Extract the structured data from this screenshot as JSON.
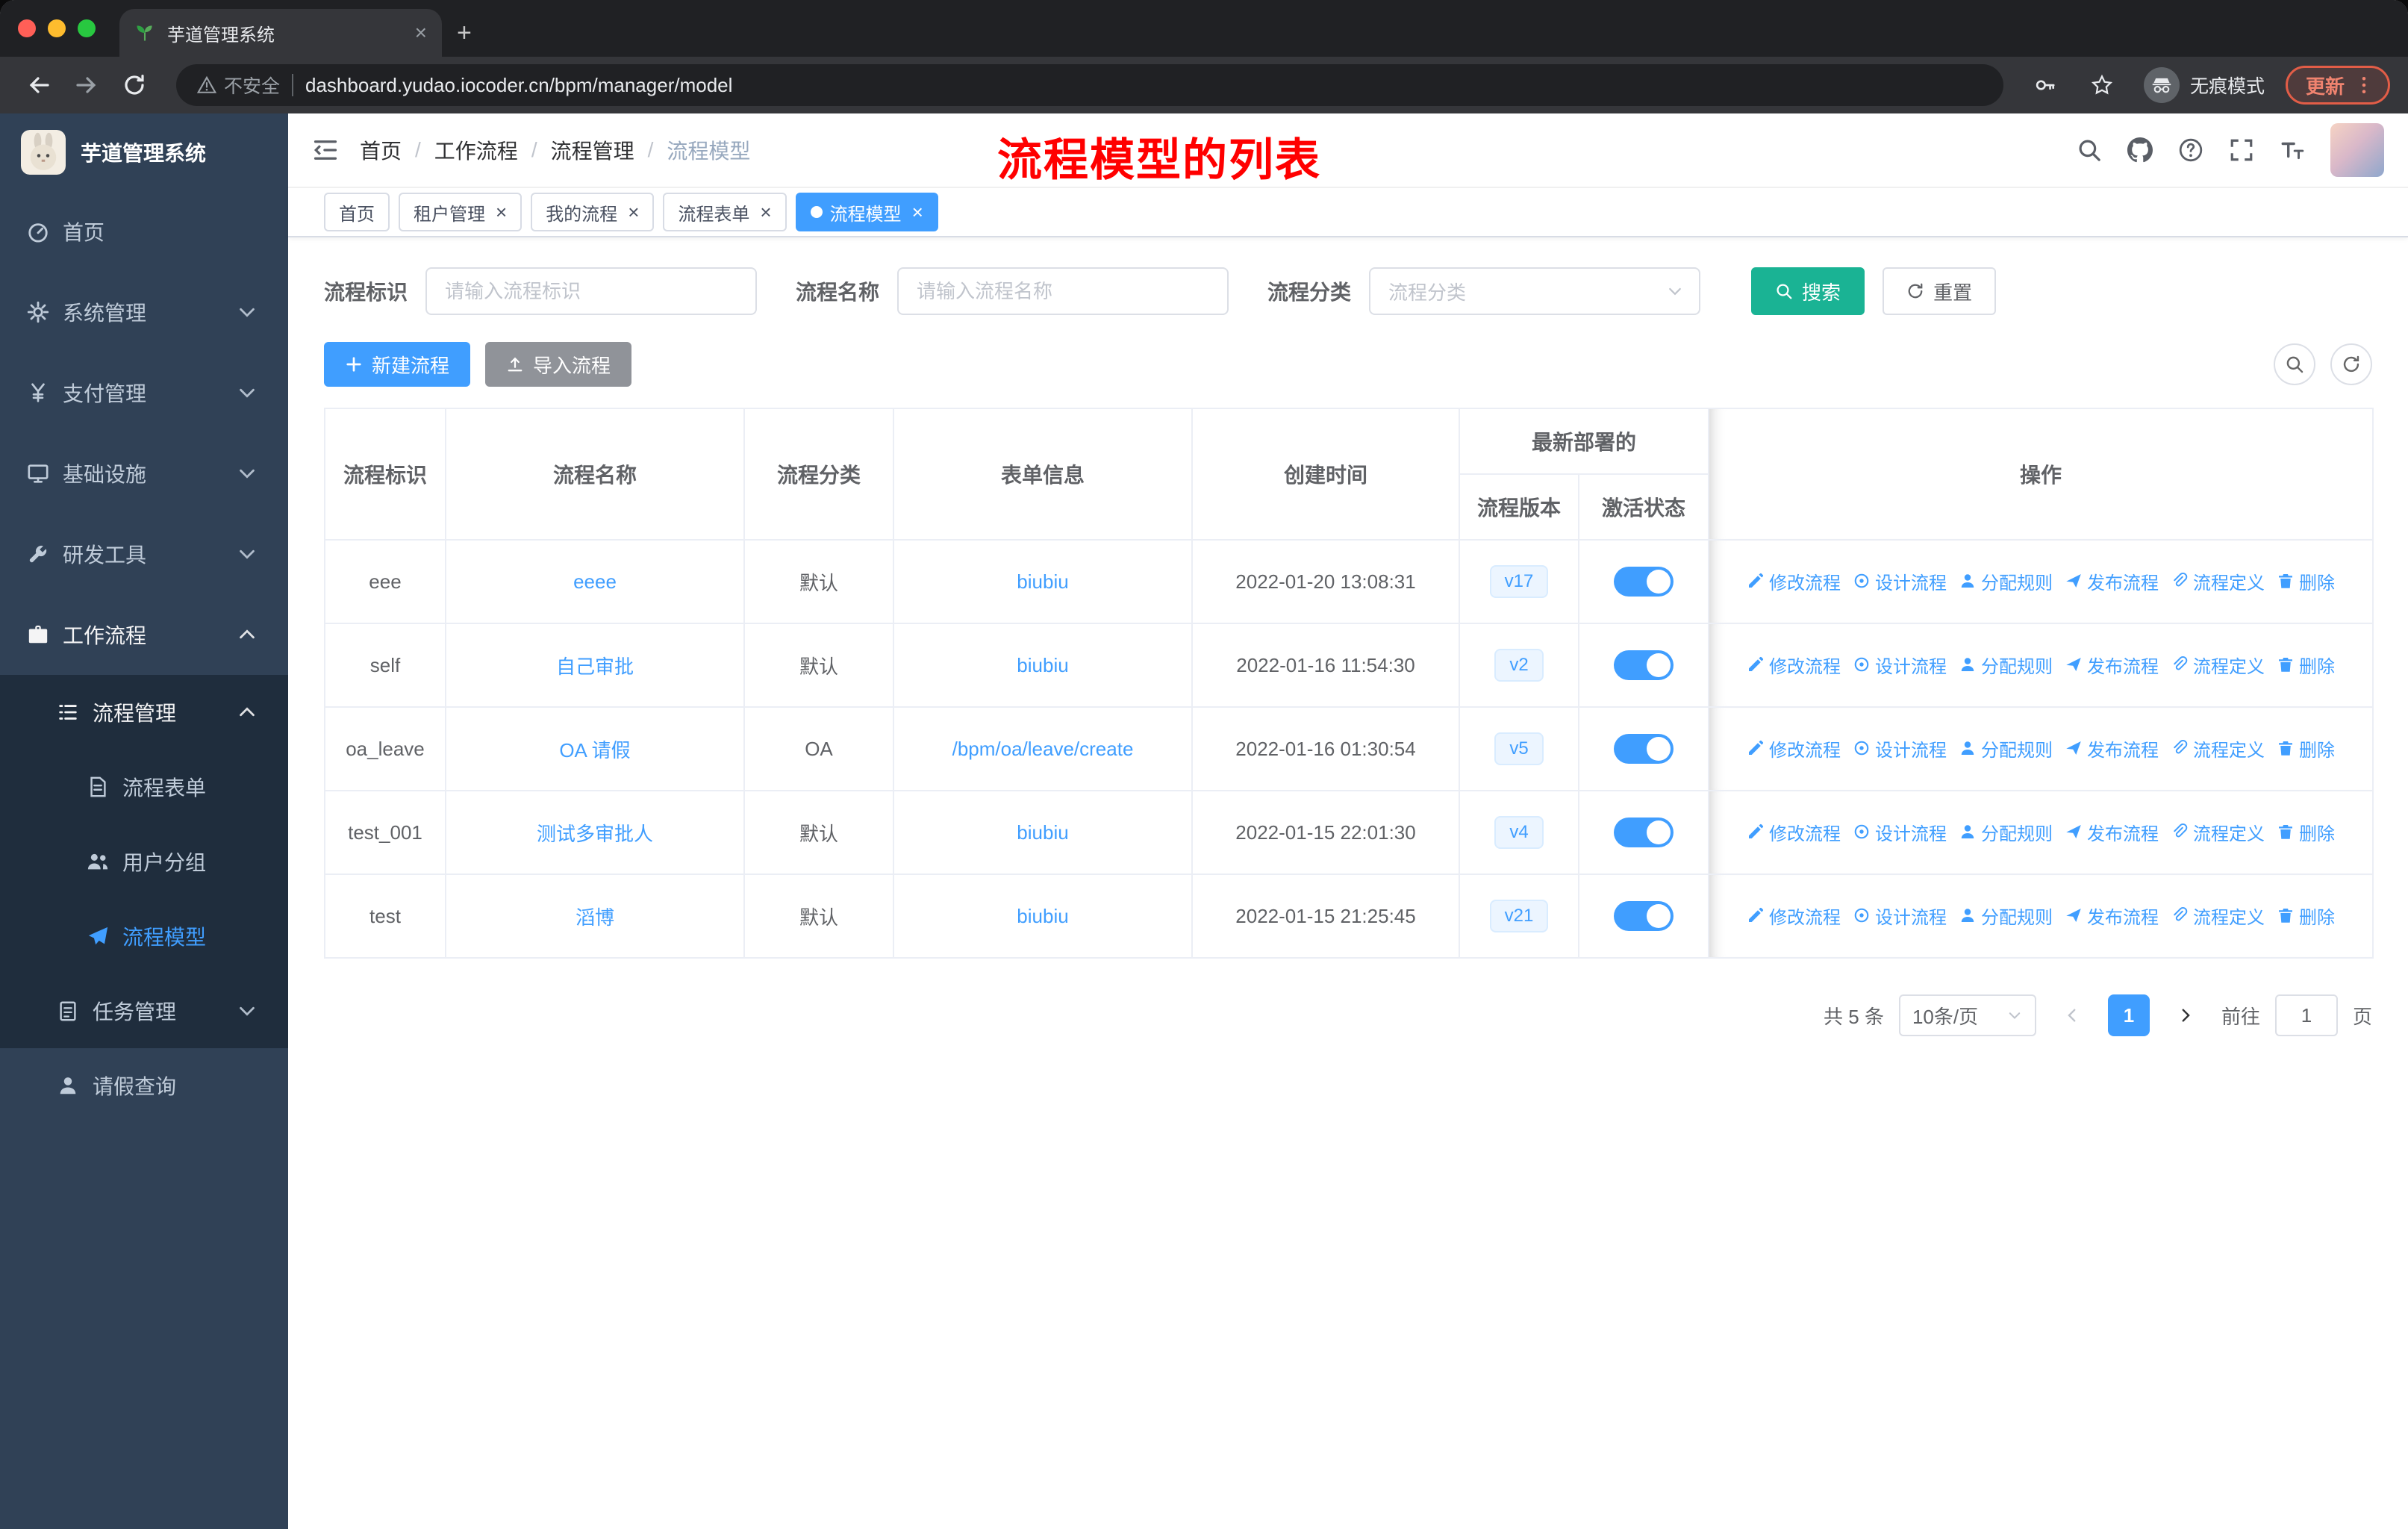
{
  "browser": {
    "tab": {
      "title": "芋道管理系统",
      "favicon": "favicon-leaf-icon"
    },
    "nav": {
      "url": "dashboard.yudao.iocoder.cn/bpm/manager/model",
      "security_label": "不安全",
      "incognito_label": "无痕模式",
      "update_label": "更新"
    }
  },
  "sidebar": {
    "title": "芋道管理系统",
    "menu": [
      {
        "name": "home",
        "label": "首页",
        "icon": "dashboard-icon",
        "level": 1
      },
      {
        "name": "system",
        "label": "系统管理",
        "icon": "gear-icon",
        "level": 1,
        "arrow": "down"
      },
      {
        "name": "payment",
        "label": "支付管理",
        "icon": "yen-icon",
        "level": 1,
        "arrow": "down"
      },
      {
        "name": "infrastructure",
        "label": "基础设施",
        "icon": "monitor-icon",
        "level": 1,
        "arrow": "down"
      },
      {
        "name": "dev-tools",
        "label": "研发工具",
        "icon": "wrench-icon",
        "level": 1,
        "arrow": "down"
      },
      {
        "name": "workflow",
        "label": "工作流程",
        "icon": "briefcase-icon",
        "level": 1,
        "arrow": "up",
        "open": true
      },
      {
        "name": "process-mgmt",
        "label": "流程管理",
        "icon": "list-tree-icon",
        "level": 2,
        "arrow": "up",
        "open": true,
        "panel": true
      },
      {
        "name": "process-form",
        "label": "流程表单",
        "icon": "document-icon",
        "level": 3,
        "panel": true
      },
      {
        "name": "user-group",
        "label": "用户分组",
        "icon": "users-icon",
        "level": 3,
        "panel": true
      },
      {
        "name": "process-model",
        "label": "流程模型",
        "icon": "paper-plane-icon",
        "level": 3,
        "panel": true,
        "active": true
      },
      {
        "name": "task-mgmt",
        "label": "任务管理",
        "icon": "task-icon",
        "level": 2,
        "arrow": "down",
        "panel": true
      },
      {
        "name": "leave-query",
        "label": "请假查询",
        "icon": "user-icon",
        "level": 2
      }
    ]
  },
  "header": {
    "breadcrumb": [
      "首页",
      "工作流程",
      "流程管理",
      "流程模型"
    ],
    "annotation": "流程模型的列表",
    "icons": [
      "search-icon",
      "github-icon",
      "question-icon",
      "fullscreen-icon",
      "font-size-icon"
    ]
  },
  "tabs": [
    {
      "label": "首页",
      "closable": false,
      "active": false
    },
    {
      "label": "租户管理",
      "closable": true,
      "active": false
    },
    {
      "label": "我的流程",
      "closable": true,
      "active": false
    },
    {
      "label": "流程表单",
      "closable": true,
      "active": false
    },
    {
      "label": "流程模型",
      "closable": true,
      "active": true
    }
  ],
  "filters": {
    "key_label": "流程标识",
    "key_placeholder": "请输入流程标识",
    "name_label": "流程名称",
    "name_placeholder": "请输入流程名称",
    "category_label": "流程分类",
    "category_placeholder": "流程分类",
    "search_label": "搜索",
    "reset_label": "重置"
  },
  "toolbar": {
    "create_label": "新建流程",
    "import_label": "导入流程"
  },
  "table": {
    "columns": {
      "key": "流程标识",
      "name": "流程名称",
      "category": "流程分类",
      "form": "表单信息",
      "created": "创建时间",
      "deploy_group": "最新部署的",
      "version": "流程版本",
      "active": "激活状态",
      "ops": "操作"
    },
    "actions": [
      {
        "name": "edit",
        "label": "修改流程",
        "icon": "edit-icon"
      },
      {
        "name": "design",
        "label": "设计流程",
        "icon": "design-icon"
      },
      {
        "name": "assign",
        "label": "分配规则",
        "icon": "user-icon"
      },
      {
        "name": "publish",
        "label": "发布流程",
        "icon": "publish-icon"
      },
      {
        "name": "definition",
        "label": "流程定义",
        "icon": "definition-icon"
      },
      {
        "name": "delete",
        "label": "删除",
        "icon": "delete-icon"
      }
    ],
    "rows": [
      {
        "key": "eee",
        "name": "eeee",
        "category": "默认",
        "form": "biubiu",
        "created": "2022-01-20 13:08:31",
        "version": "v17",
        "active": true
      },
      {
        "key": "self",
        "name": "自己审批",
        "category": "默认",
        "form": "biubiu",
        "created": "2022-01-16 11:54:30",
        "version": "v2",
        "active": true
      },
      {
        "key": "oa_leave",
        "name": "OA 请假",
        "category": "OA",
        "form": "/bpm/oa/leave/create",
        "created": "2022-01-16 01:30:54",
        "version": "v5",
        "active": true
      },
      {
        "key": "test_001",
        "name": "测试多审批人",
        "category": "默认",
        "form": "biubiu",
        "created": "2022-01-15 22:01:30",
        "version": "v4",
        "active": true
      },
      {
        "key": "test",
        "name": "滔博",
        "category": "默认",
        "form": "biubiu",
        "created": "2022-01-15 21:25:45",
        "version": "v21",
        "active": true
      }
    ]
  },
  "pagination": {
    "total_label": "共 5 条",
    "page_size_label": "10条/页",
    "current_page": "1",
    "goto_label": "前往",
    "goto_value": "1",
    "page_unit": "页"
  },
  "colors": {
    "primary": "#409eff",
    "search_button": "#1ab394",
    "import_button": "#909399",
    "sidebar_bg": "#304156",
    "annotation": "#ff0000",
    "update_chip": "#e25d47"
  }
}
